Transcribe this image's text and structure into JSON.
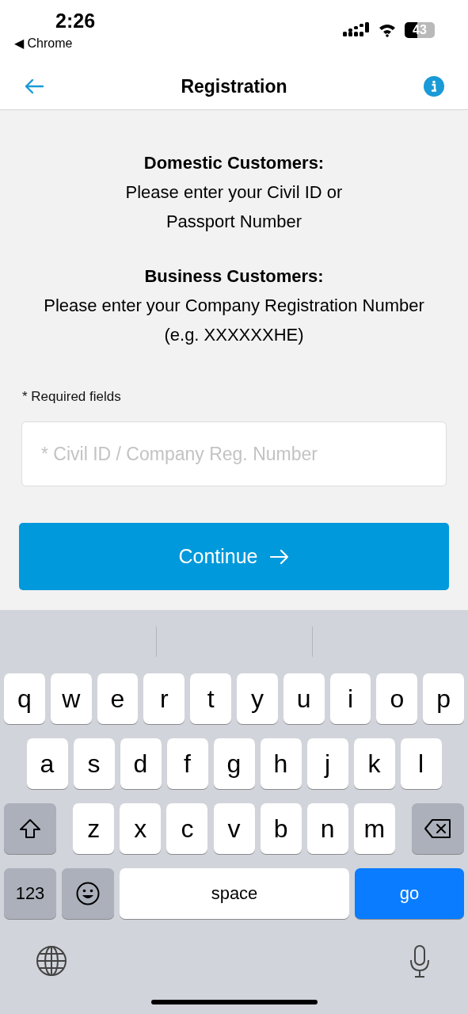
{
  "status_bar": {
    "time": "2:26",
    "back_app": "◀ Chrome",
    "battery": "43"
  },
  "nav": {
    "title": "Registration"
  },
  "intro": [
    {
      "heading": "Domestic Customers:",
      "text": "Please enter your Civil ID or Passport Number"
    },
    {
      "heading": "Business Customers:",
      "text": "Please enter your Company Registration Number (e.g. XXXXXXHE)"
    }
  ],
  "required_note": "* Required fields",
  "id_field": {
    "placeholder": "* Civil ID / Company Reg. Number"
  },
  "continue_button": {
    "label": "Continue"
  },
  "keyboard": {
    "key_rows": [
      {
        "keys": [
          {
            "kind": "letter",
            "label": "q"
          },
          {
            "kind": "letter",
            "label": "w"
          },
          {
            "kind": "letter",
            "label": "e"
          },
          {
            "kind": "letter",
            "label": "r"
          },
          {
            "kind": "letter",
            "label": "t"
          },
          {
            "kind": "letter",
            "label": "y"
          },
          {
            "kind": "letter",
            "label": "u"
          },
          {
            "kind": "letter",
            "label": "i"
          },
          {
            "kind": "letter",
            "label": "o"
          },
          {
            "kind": "letter",
            "label": "p"
          }
        ]
      },
      {
        "keys": [
          {
            "kind": "letter",
            "label": "a"
          },
          {
            "kind": "letter",
            "label": "s"
          },
          {
            "kind": "letter",
            "label": "d"
          },
          {
            "kind": "letter",
            "label": "f"
          },
          {
            "kind": "letter",
            "label": "g"
          },
          {
            "kind": "letter",
            "label": "h"
          },
          {
            "kind": "letter",
            "label": "j"
          },
          {
            "kind": "letter",
            "label": "k"
          },
          {
            "kind": "letter",
            "label": "l"
          }
        ]
      },
      {
        "keys": [
          {
            "kind": "shift"
          },
          {
            "kind": "letter",
            "label": "z"
          },
          {
            "kind": "letter",
            "label": "x"
          },
          {
            "kind": "letter",
            "label": "c"
          },
          {
            "kind": "letter",
            "label": "v"
          },
          {
            "kind": "letter",
            "label": "b"
          },
          {
            "kind": "letter",
            "label": "n"
          },
          {
            "kind": "letter",
            "label": "m"
          },
          {
            "kind": "delete"
          }
        ]
      },
      {
        "keys": [
          {
            "kind": "numbers",
            "label": "123"
          },
          {
            "kind": "emoji"
          },
          {
            "kind": "space",
            "label": "space"
          },
          {
            "kind": "go",
            "label": "go"
          }
        ]
      }
    ]
  }
}
